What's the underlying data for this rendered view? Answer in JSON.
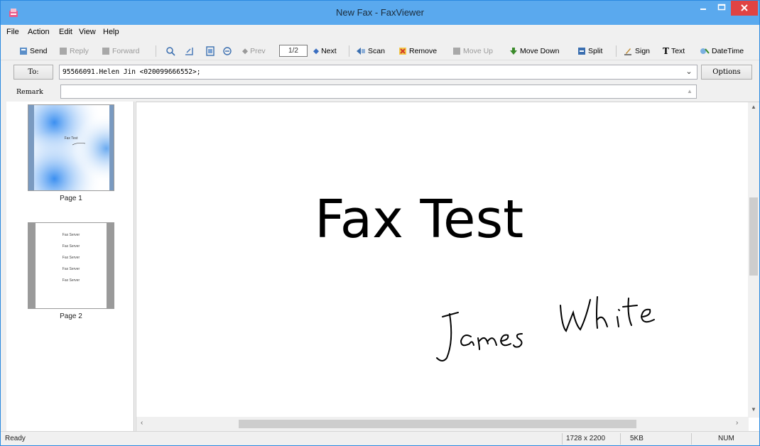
{
  "window": {
    "title": "New Fax - FaxViewer"
  },
  "menu": [
    "File",
    "Action",
    "Edit",
    "View",
    "Help"
  ],
  "toolbar": {
    "send": "Send",
    "reply": "Reply",
    "forward": "Forward",
    "pager": "1/2",
    "prev": "Prev",
    "next": "Next",
    "scan": "Scan",
    "remove": "Remove",
    "move_up": "Move Up",
    "move_down": "Move Down",
    "split": "Split",
    "sign": "Sign",
    "text": "Text",
    "datetime": "DateTime"
  },
  "to": {
    "button": "To:",
    "value": "95566091.Helen Jin <020099666552>;",
    "options": "Options"
  },
  "remark": {
    "label": "Remark",
    "value": ""
  },
  "thumbnails": [
    {
      "label": "Page 1",
      "mini_text": "Fax Test"
    },
    {
      "label": "Page 2",
      "lines": [
        "Fax Server",
        "Fax Server",
        "Fax Server",
        "Fax Server",
        "Fax Server"
      ]
    }
  ],
  "page": {
    "heading": "Fax Test",
    "signature": "James White"
  },
  "status": {
    "state": "Ready",
    "dimensions": "1728 x 2200",
    "size": "5KB",
    "num": "NUM"
  },
  "colors": {
    "titlebar": "#5aa9ee",
    "close": "#e04343",
    "accent_green": "#3a8a2a",
    "accent_red": "#d23a2a"
  }
}
